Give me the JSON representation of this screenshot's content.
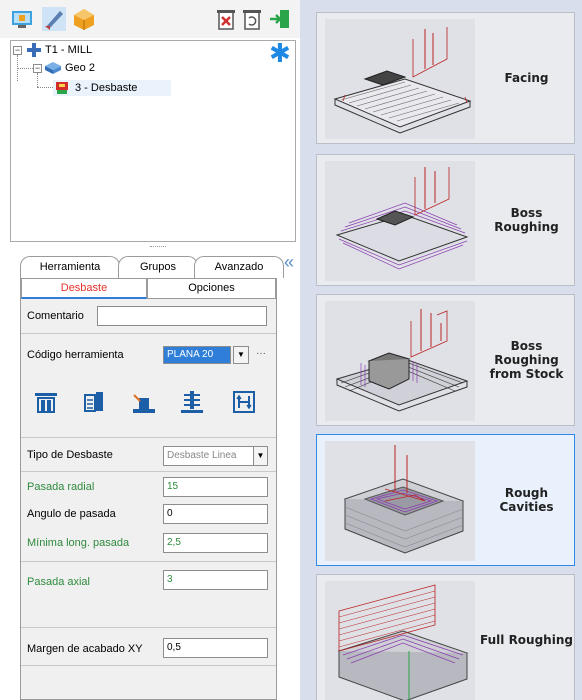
{
  "tree": {
    "tool": "T1 - MILL",
    "geometry": "Geo 2",
    "operation": "3 - Desbaste"
  },
  "tabs": [
    "Herramienta",
    "Grupos",
    "Avanzado"
  ],
  "subtabs": [
    "Desbaste",
    "Opciones"
  ],
  "form": {
    "comentario_label": "Comentario",
    "comentario_value": "",
    "codigo_label": "Código herramienta",
    "codigo_value": "PLANA 20",
    "codigo_more": "···",
    "tipo_label": "Tipo de Desbaste",
    "tipo_value": "Desbaste Linea",
    "pasada_radial_label": "Pasada radial",
    "pasada_radial_value": "15",
    "angulo_label": "Angulo de pasada",
    "angulo_value": "0",
    "minima_label": "Mínima long. pasada",
    "minima_value": "2,5",
    "pasada_axial_label": "Pasada axial",
    "pasada_axial_value": "3",
    "margen_label": "Margen de acabado XY",
    "margen_value": "0,5"
  },
  "strategies": [
    {
      "label": "Facing",
      "selected": false
    },
    {
      "label": "Boss Roughing",
      "selected": false
    },
    {
      "label": "Boss Roughing from Stock",
      "selected": false
    },
    {
      "label": "Rough Cavities",
      "selected": true
    },
    {
      "label": "Full Roughing",
      "selected": false
    }
  ],
  "icons": {
    "toolbar": [
      "machine-icon",
      "tool-icon",
      "part-icon",
      "delete-icon",
      "copy-icon",
      "exit-icon"
    ],
    "strategy_bar": [
      "facing-strategy-icon",
      "pocket-strategy-icon",
      "boss-strategy-icon",
      "level-strategy-icon",
      "adaptive-strategy-icon"
    ]
  },
  "colors": {
    "accent_blue": "#2e8ae6",
    "active_tab_red": "#e3322a",
    "green_label": "#2e8b3d",
    "right_bg": "#d8deeb"
  }
}
